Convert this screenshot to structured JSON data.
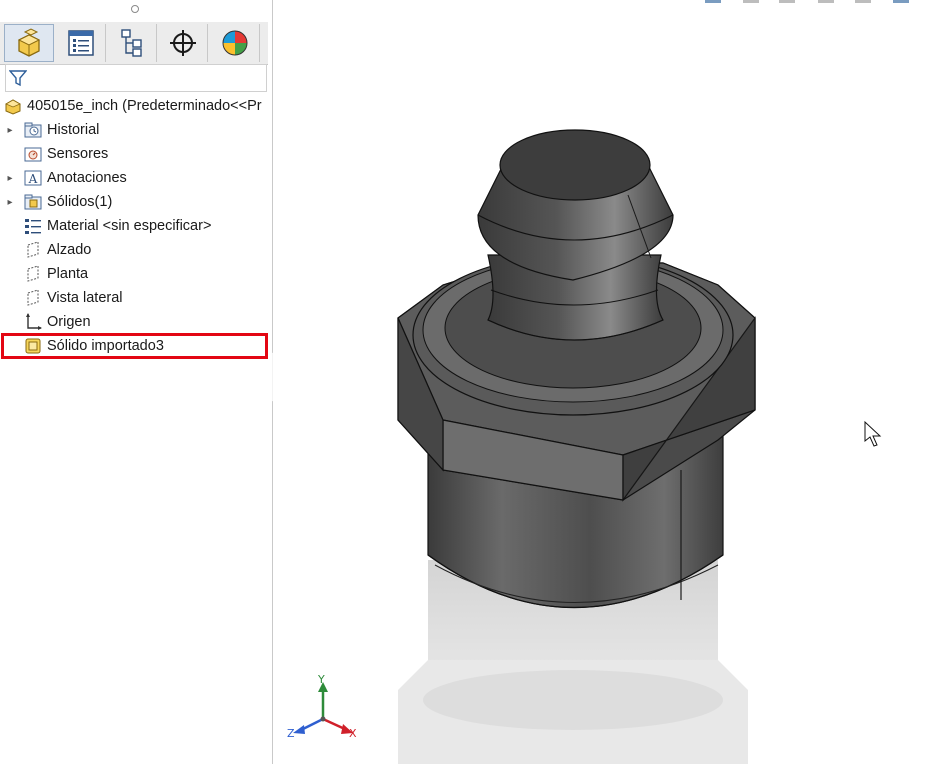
{
  "tabs": [
    {
      "icon": "part-feature-manager-icon",
      "label": ""
    },
    {
      "icon": "property-manager-icon",
      "label": ""
    },
    {
      "icon": "configuration-manager-icon",
      "label": ""
    },
    {
      "icon": "dimxpert-manager-icon",
      "label": ""
    },
    {
      "icon": "display-manager-icon",
      "label": ""
    }
  ],
  "tree": {
    "root": "405015e_inch  (Predeterminado<<Pr",
    "items": [
      {
        "label": "Historial",
        "icon": "history-folder-icon",
        "expandable": true
      },
      {
        "label": "Sensores",
        "icon": "sensors-icon",
        "expandable": false
      },
      {
        "label": "Anotaciones",
        "icon": "annotations-icon",
        "expandable": true
      },
      {
        "label": "Sólidos(1)",
        "icon": "solid-bodies-icon",
        "expandable": true
      },
      {
        "label": "Material <sin especificar>",
        "icon": "material-icon",
        "expandable": false
      },
      {
        "label": "Alzado",
        "icon": "plane-icon",
        "expandable": false
      },
      {
        "label": "Planta",
        "icon": "plane-icon",
        "expandable": false
      },
      {
        "label": "Vista lateral",
        "icon": "plane-icon",
        "expandable": false
      },
      {
        "label": "Origen",
        "icon": "origin-icon",
        "expandable": false
      },
      {
        "label": "Sólido importado3",
        "icon": "imported-body-icon",
        "expandable": false
      }
    ]
  },
  "triad": {
    "x": "X",
    "y": "Y",
    "z": "Z"
  },
  "colors": {
    "highlight": "#e30613",
    "x_axis": "#d0202a",
    "y_axis": "#2e8b3a",
    "z_axis": "#2f5fd0",
    "model": "#5a5a5a"
  }
}
